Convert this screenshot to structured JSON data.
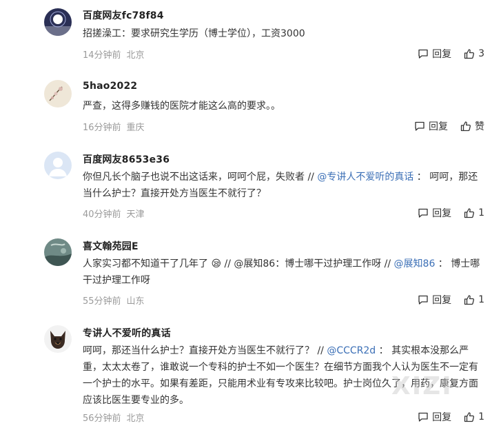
{
  "comments": [
    {
      "username": "百度网友fc78f84",
      "content_parts": [
        "招搓澡工：要求研究生学历（博士学位），工资3000"
      ],
      "time": "14分钟前",
      "location": "北京",
      "reply_label": "回复",
      "like_label": "3"
    },
    {
      "username": "5hao2022",
      "content_parts": [
        "严查，这得多赚钱的医院才能这么高的要求。。"
      ],
      "time": "16分钟前",
      "location": "重庆",
      "reply_label": "回复",
      "like_label": "赞"
    },
    {
      "username": "百度网友8653e36",
      "content_parts": [
        "你但凡长个脑子也说不出这话来，呵呵个屁，失败者 // ",
        "@专讲人不爱听的真话",
        " ： 呵呵，那还当什么护士？直接开处方当医生不就行了？"
      ],
      "time": "40分钟前",
      "location": "天津",
      "reply_label": "回复",
      "like_label": "1"
    },
    {
      "username": "喜文翰苑园E",
      "content_parts": [
        "人家实习都不知道干了几年了 😪 // @展知86：博士哪干过护理工作呀 // ",
        "@展知86",
        " ： 博士哪干过护理工作呀"
      ],
      "time": "55分钟前",
      "location": "山东",
      "reply_label": "回复",
      "like_label": "1"
    },
    {
      "username": "专讲人不爱听的真话",
      "content_parts": [
        "呵呵，那还当什么护士？直接开处方当医生不就行了？ // ",
        "@CCCR2d",
        " ： 其实根本没那么严重，太太太卷了，谁敢说一个专科的护士不如一个医生？在细节方面我个人认为医生不一定有一个护士的水平。如果有差距，只能用术业有专攻来比较吧。护士岗位久了，用药，康复方面应该比医生要专业的多。"
      ],
      "time": "56分钟前",
      "location": "北京",
      "reply_label": "回复",
      "like_label": "1"
    }
  ],
  "watermark": "XIZI",
  "colors": {
    "mention": "#3b6fb6",
    "meta": "#9a9a9a"
  },
  "icons": {
    "reply": "comment-bubble-icon",
    "like": "thumbs-up-icon"
  }
}
